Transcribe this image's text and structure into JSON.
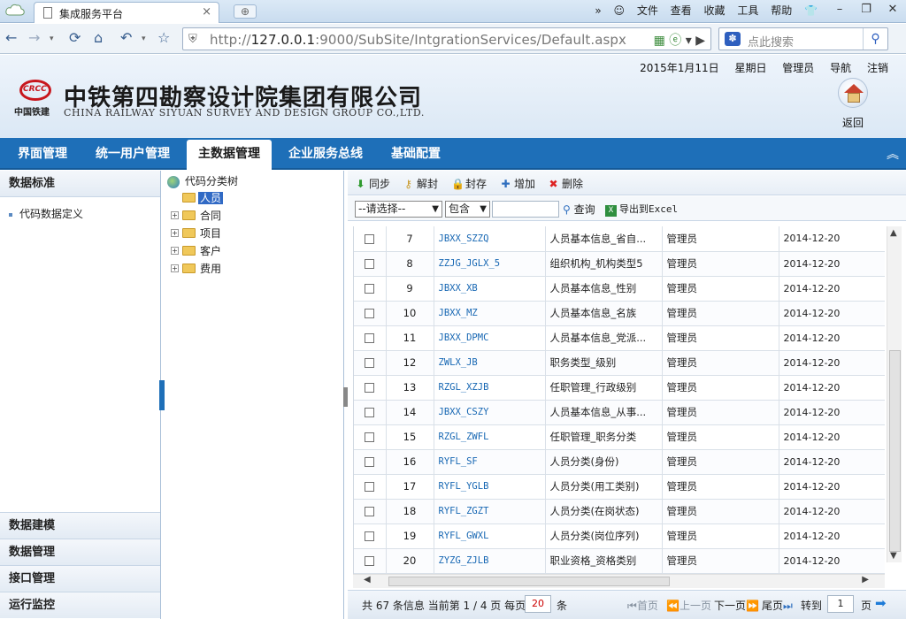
{
  "browser": {
    "tab_title": "集成服务平台",
    "tab_close": "×",
    "new_tab": "⊕",
    "menus": [
      "文件",
      "查看",
      "收藏",
      "工具",
      "帮助"
    ],
    "url_prefix": "http://",
    "url_host": "127.0.0.1",
    "url_path": ":9000/SubSite/IntgrationServices/Default.aspx",
    "search_placeholder": "点此搜索"
  },
  "header": {
    "logo_text": "CRCC",
    "logo_caption": "中国铁建",
    "company_cn": "中铁第四勘察设计院集团有限公司",
    "company_en": "CHINA RAILWAY SIYUAN SURVEY AND DESIGN GROUP CO.,LTD.",
    "date": "2015年1月11日",
    "weekday": "星期日",
    "user": "管理员",
    "nav": "导航",
    "logout": "注销",
    "home_label": "返回"
  },
  "main_menu": [
    "界面管理",
    "统一用户管理",
    "主数据管理",
    "企业服务总线",
    "基础配置"
  ],
  "left_panel": {
    "header": "数据标准",
    "item": "代码数据定义",
    "bottom": [
      "数据建模",
      "数据管理",
      "接口管理",
      "运行监控"
    ]
  },
  "tree": {
    "root": "代码分类树",
    "nodes": [
      "人员",
      "合同",
      "项目",
      "客户",
      "费用"
    ]
  },
  "toolbar": {
    "sync": "同步",
    "unlock": "解封",
    "lock": "封存",
    "add": "增加",
    "delete": "删除"
  },
  "filter": {
    "select_field": "--请选择--",
    "select_op": "包含",
    "query": "查询",
    "export": "导出到Excel"
  },
  "rows": [
    {
      "no": "7",
      "code": "JBXX_SZZQ",
      "name": "人员基本信息_省自...",
      "creator": "管理员",
      "date": "2014-12-20"
    },
    {
      "no": "8",
      "code": "ZZJG_JGLX_5",
      "name": "组织机构_机构类型5",
      "creator": "管理员",
      "date": "2014-12-20"
    },
    {
      "no": "9",
      "code": "JBXX_XB",
      "name": "人员基本信息_性别",
      "creator": "管理员",
      "date": "2014-12-20"
    },
    {
      "no": "10",
      "code": "JBXX_MZ",
      "name": "人员基本信息_名族",
      "creator": "管理员",
      "date": "2014-12-20"
    },
    {
      "no": "11",
      "code": "JBXX_DPMC",
      "name": "人员基本信息_党派...",
      "creator": "管理员",
      "date": "2014-12-20"
    },
    {
      "no": "12",
      "code": "ZWLX_JB",
      "name": "职务类型_级别",
      "creator": "管理员",
      "date": "2014-12-20"
    },
    {
      "no": "13",
      "code": "RZGL_XZJB",
      "name": "任职管理_行政级别",
      "creator": "管理员",
      "date": "2014-12-20"
    },
    {
      "no": "14",
      "code": "JBXX_CSZY",
      "name": "人员基本信息_从事...",
      "creator": "管理员",
      "date": "2014-12-20"
    },
    {
      "no": "15",
      "code": "RZGL_ZWFL",
      "name": "任职管理_职务分类",
      "creator": "管理员",
      "date": "2014-12-20"
    },
    {
      "no": "16",
      "code": "RYFL_SF",
      "name": "人员分类(身份)",
      "creator": "管理员",
      "date": "2014-12-20"
    },
    {
      "no": "17",
      "code": "RYFL_YGLB",
      "name": "人员分类(用工类别)",
      "creator": "管理员",
      "date": "2014-12-20"
    },
    {
      "no": "18",
      "code": "RYFL_ZGZT",
      "name": "人员分类(在岗状态)",
      "creator": "管理员",
      "date": "2014-12-20"
    },
    {
      "no": "19",
      "code": "RYFL_GWXL",
      "name": "人员分类(岗位序列)",
      "creator": "管理员",
      "date": "2014-12-20"
    },
    {
      "no": "20",
      "code": "ZYZG_ZJLB",
      "name": "职业资格_资格类别",
      "creator": "管理员",
      "date": "2014-12-20"
    }
  ],
  "pager": {
    "info": "共 67 条信息 当前第 1 / 4 页",
    "per_page_label": "每页",
    "page_size": "20",
    "unit": "条",
    "first": "首页",
    "prev": "上一页",
    "next": "下一页",
    "last": "尾页",
    "goto": "转到",
    "page_number": "1",
    "page_unit": "页"
  },
  "colors": {
    "menu_blue": "#1e6fb8",
    "link_blue": "#1767b3",
    "brand_red": "#c8161d"
  }
}
